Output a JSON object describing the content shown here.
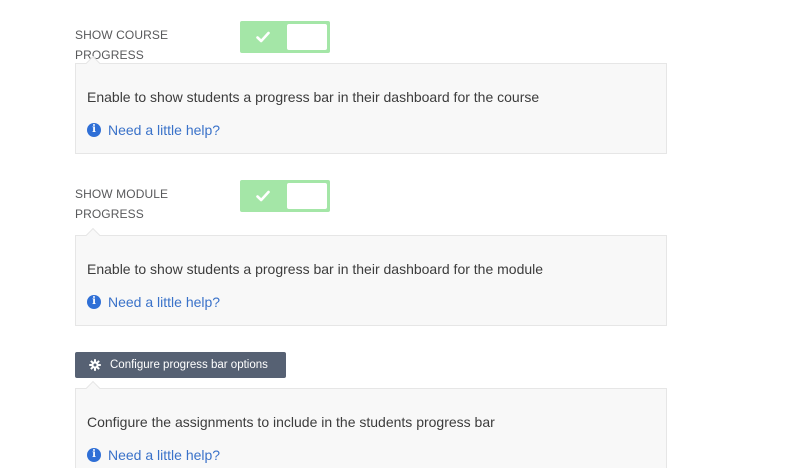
{
  "course_progress": {
    "label": "SHOW COURSE PROGRESS",
    "toggle_on": true,
    "description": "Enable to show students a progress bar in their dashboard for the course",
    "help_text": "Need a little help?"
  },
  "module_progress": {
    "label": "SHOW MODULE PROGRESS",
    "toggle_on": true,
    "description": "Enable to show students a progress bar in their dashboard for the module",
    "help_text": "Need a little help?"
  },
  "configure": {
    "button_label": "Configure progress bar options",
    "description": "Configure the assignments to include in the students progress bar",
    "help_text": "Need a little help?"
  },
  "colors": {
    "toggle_on": "#a4e6a7",
    "button_bg": "#566173",
    "link": "#3a72c9",
    "info_icon": "#2f6fd6"
  },
  "icons": {
    "toggle": "check-icon",
    "help": "info-icon",
    "configure": "gear-icon"
  }
}
